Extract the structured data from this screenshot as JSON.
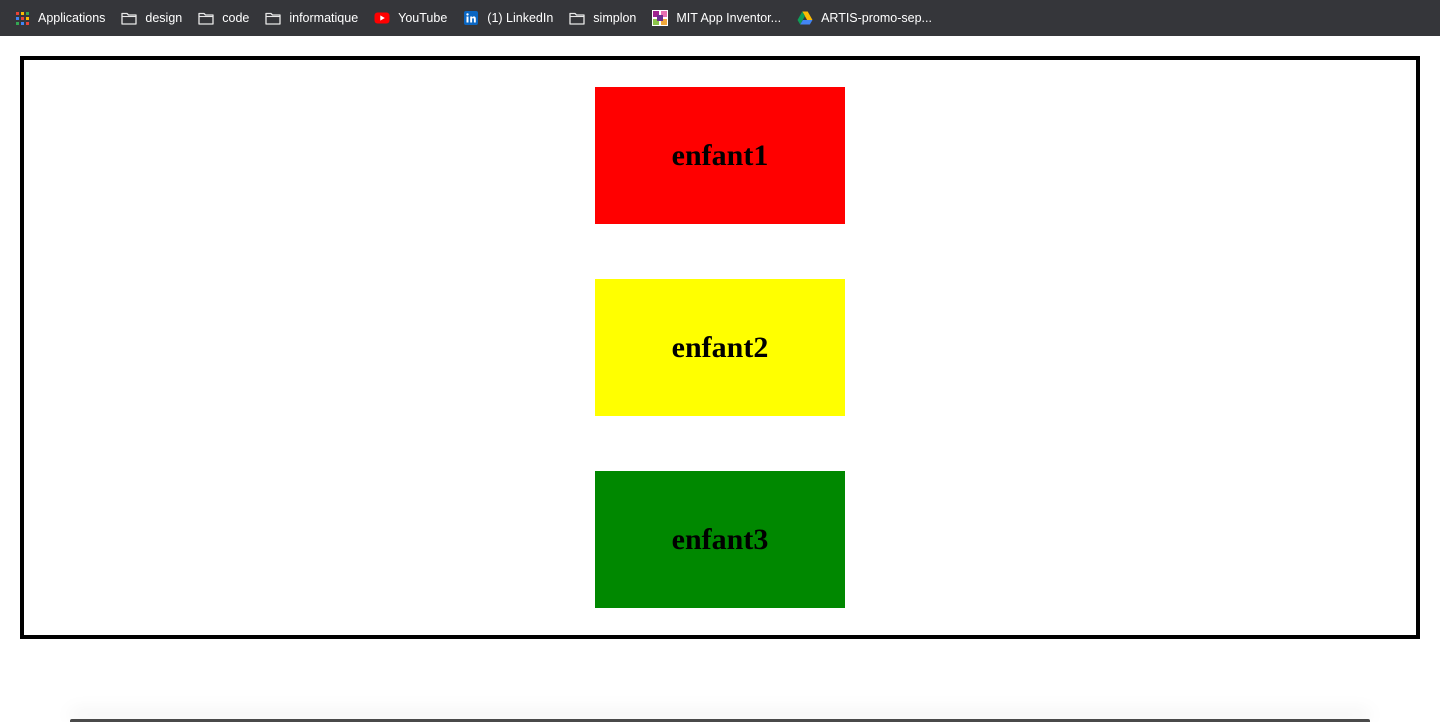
{
  "bookmarks": [
    {
      "label": "Applications",
      "icon": "apps-grid-icon"
    },
    {
      "label": "design",
      "icon": "folder-icon"
    },
    {
      "label": "code",
      "icon": "folder-icon"
    },
    {
      "label": "informatique",
      "icon": "folder-icon"
    },
    {
      "label": "YouTube",
      "icon": "youtube-icon"
    },
    {
      "label": "(1) LinkedIn",
      "icon": "linkedin-icon"
    },
    {
      "label": "simplon",
      "icon": "folder-icon"
    },
    {
      "label": "MIT App Inventor...",
      "icon": "mit-app-inventor-icon"
    },
    {
      "label": "ARTIS-promo-sep...",
      "icon": "google-drive-icon"
    }
  ],
  "page": {
    "children": [
      {
        "label": "enfant1",
        "color": "#ff0000"
      },
      {
        "label": "enfant2",
        "color": "#ffff00"
      },
      {
        "label": "enfant3",
        "color": "#008800"
      }
    ],
    "frame_border_color": "#000000"
  },
  "colors": {
    "bookmarks_bar_bg": "#35363a",
    "bookmarks_text": "#ffffff",
    "page_bg": "#ffffff"
  }
}
